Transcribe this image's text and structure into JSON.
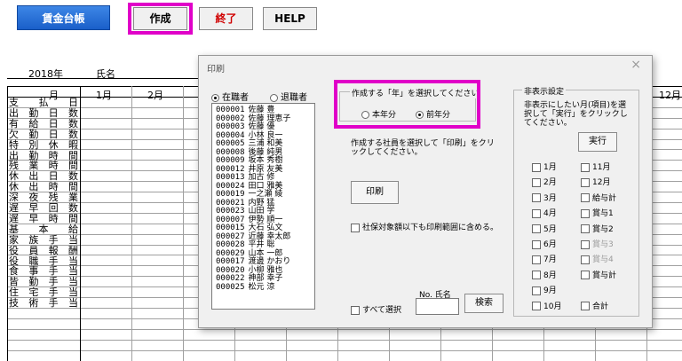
{
  "toolbar": {
    "ledger_label": "賃金台帳",
    "create_label": "作成",
    "end_label": "終了",
    "help_label": "HELP"
  },
  "sheet": {
    "year": "2018年",
    "name_label": "氏名",
    "month_header": "月",
    "month_cols": [
      "1月",
      "2月",
      "12月"
    ],
    "row_labels": [
      "支払日",
      "出勤日数",
      "有給日数",
      "欠勤日数",
      "特別休暇",
      "出勤時間",
      "残業時間",
      "休出日数",
      "休出時間",
      "深夜残業",
      "遅早回数",
      "遅早時間",
      "基本給",
      "家族手当",
      "役員報酬",
      "役職手当",
      "食事手当",
      "皆勤手当",
      "住宅手当",
      "技術手当"
    ]
  },
  "dialog": {
    "title": "印刷",
    "close_glyph": "×",
    "status_enrolled": "在職者",
    "status_retired": "退職者",
    "employees": [
      {
        "no": "000001",
        "name": "佐藤 豊"
      },
      {
        "no": "000002",
        "name": "佐藤 理恵子"
      },
      {
        "no": "000003",
        "name": "佐藤 優"
      },
      {
        "no": "000004",
        "name": "小林 良一"
      },
      {
        "no": "000005",
        "name": "三浦 和美"
      },
      {
        "no": "000008",
        "name": "後藤 純男"
      },
      {
        "no": "000009",
        "name": "坂本 秀樹"
      },
      {
        "no": "000012",
        "name": "井原 友美"
      },
      {
        "no": "000013",
        "name": "加古 修"
      },
      {
        "no": "000024",
        "name": "田口 雅美"
      },
      {
        "no": "000019",
        "name": "一之瀬 綾"
      },
      {
        "no": "000021",
        "name": "内野 猛"
      },
      {
        "no": "000023",
        "name": "山田 学"
      },
      {
        "no": "000007",
        "name": "伊勢 順一"
      },
      {
        "no": "000015",
        "name": "大石 弘文"
      },
      {
        "no": "000027",
        "name": "近藤 幸太郎"
      },
      {
        "no": "000028",
        "name": "平井 聡"
      },
      {
        "no": "000029",
        "name": "山本 一郎"
      },
      {
        "no": "000017",
        "name": "渡邊 かおり"
      },
      {
        "no": "000020",
        "name": "小柳 雅也"
      },
      {
        "no": "000022",
        "name": "神部 幸子"
      },
      {
        "no": "000025",
        "name": "松元 涼"
      }
    ],
    "year_group_label": "作成する「年」を選択してください",
    "year_this": "本年分",
    "year_prev": "前年分",
    "instruction": "作成する社員を選択して「印刷」をクリックしてください。",
    "print_label": "印刷",
    "social_insurance_label": "社保対象額以下も印刷範囲に含める。",
    "select_all_label": "すべて選択",
    "search_no_label": "No. 氏名",
    "search_label": "検索",
    "hidden_group_label": "非表示設定",
    "hidden_instruction": "非表示にしたい月(項目)を選択して「実行」をクリックしてください。",
    "execute_label": "実行",
    "hide_items_left": [
      "1月",
      "2月",
      "3月",
      "4月",
      "5月",
      "6月",
      "7月",
      "8月",
      "9月",
      "10月"
    ],
    "hide_items_right": [
      "11月",
      "12月",
      "給与計",
      "賞与1",
      "賞与2",
      "賞与3",
      "賞与4",
      "賞与計",
      "",
      "合計"
    ]
  },
  "colors": {
    "highlight": "#e000c8",
    "ledger_button": "#1a5fc9",
    "end_text": "#d00000"
  }
}
